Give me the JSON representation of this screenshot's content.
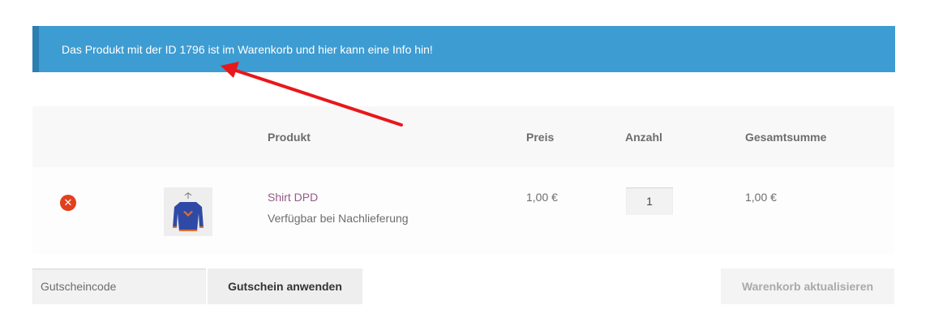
{
  "notice": {
    "text": "Das Produkt mit der ID 1796 ist im Warenkorb und hier kann eine Info hin!"
  },
  "table": {
    "headers": {
      "product": "Produkt",
      "price": "Preis",
      "quantity": "Anzahl",
      "total": "Gesamtsumme"
    },
    "rows": [
      {
        "remove_icon": "remove-circle-icon",
        "product_name": "Shirt DPD",
        "stock_status": "Verfügbar bei Nachlieferung",
        "price": "1,00 €",
        "quantity": "1",
        "total": "1,00 €"
      }
    ]
  },
  "coupon": {
    "placeholder": "Gutscheincode",
    "apply_label": "Gutschein anwenden"
  },
  "update_label": "Warenkorb aktualisieren",
  "colors": {
    "notice_bg": "#3d9cd2",
    "annotation_arrow": "#e8171b",
    "product_link": "#96588a",
    "remove": "#e2401c"
  }
}
